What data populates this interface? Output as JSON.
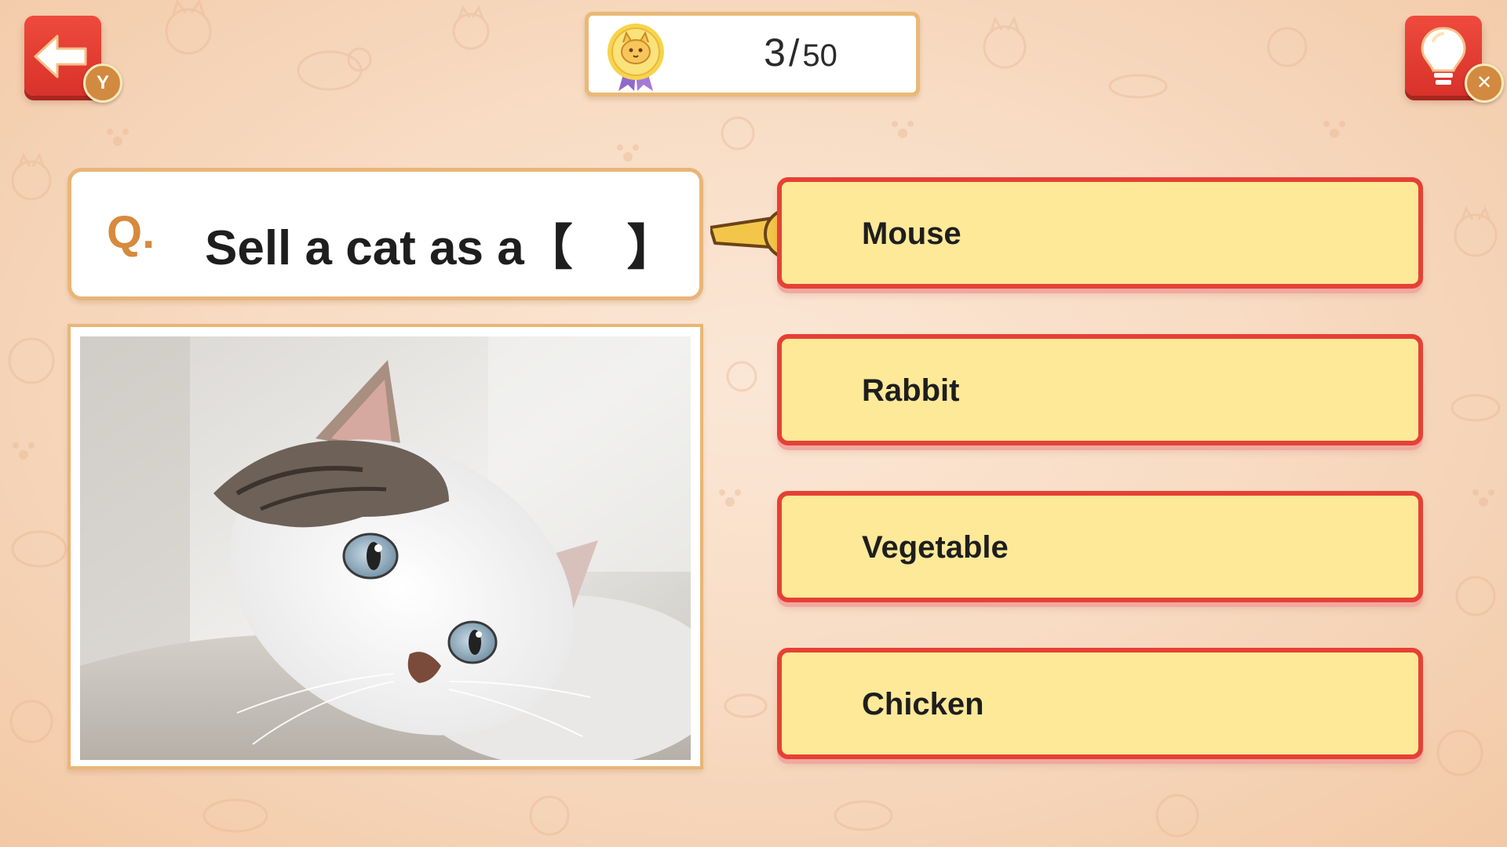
{
  "header": {
    "back_button_badge": "Y",
    "hint_button_badge": "✕",
    "back_icon": "arrow-left-icon",
    "hint_icon": "lightbulb-icon"
  },
  "score": {
    "current": "3",
    "separator": "/",
    "total": "50",
    "medal_icon": "cat-medal-icon"
  },
  "question": {
    "label": "Q.",
    "text": "Sell a cat as a【    】"
  },
  "answers": [
    {
      "label": "Mouse",
      "selected": true
    },
    {
      "label": "Rabbit",
      "selected": false
    },
    {
      "label": "Vegetable",
      "selected": false
    },
    {
      "label": "Chicken",
      "selected": false
    }
  ],
  "colors": {
    "button_red": "#e64035",
    "answer_fill": "#fde998",
    "panel_border": "#e9b577",
    "accent_orange": "#d68a3c",
    "background": "#f8dcc4"
  }
}
